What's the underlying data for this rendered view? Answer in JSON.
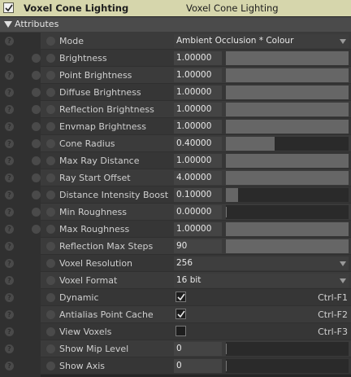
{
  "header": {
    "title": "Voxel Cone Lighting",
    "node_name": "Voxel Cone Lighting",
    "enabled": true
  },
  "section": {
    "label": "Attributes"
  },
  "rows": [
    {
      "label": "Mode",
      "type": "select",
      "value": "Ambient Occlusion * Colour"
    },
    {
      "label": "Brightness",
      "type": "slider",
      "value": "1.00000",
      "fill": 1.0
    },
    {
      "label": "Point Brightness",
      "type": "slider",
      "value": "1.00000",
      "fill": 1.0
    },
    {
      "label": "Diffuse Brightness",
      "type": "slider",
      "value": "1.00000",
      "fill": 1.0
    },
    {
      "label": "Reflection Brightness",
      "type": "slider",
      "value": "1.00000",
      "fill": 1.0
    },
    {
      "label": "Envmap Brightness",
      "type": "slider",
      "value": "1.00000",
      "fill": 1.0
    },
    {
      "label": "Cone Radius",
      "type": "slider",
      "value": "0.40000",
      "fill": 0.4
    },
    {
      "label": "Max Ray Distance",
      "type": "slider",
      "value": "1.00000",
      "fill": 1.0
    },
    {
      "label": "Ray Start Offset",
      "type": "slider",
      "value": "4.00000",
      "fill": 1.0
    },
    {
      "label": "Distance Intensity Boost",
      "type": "slider",
      "value": "0.10000",
      "fill": 0.1
    },
    {
      "label": "Min Roughness",
      "type": "slider",
      "value": "0.00000",
      "fill": 0.0
    },
    {
      "label": "Max Roughness",
      "type": "slider",
      "value": "1.00000",
      "fill": 1.0
    },
    {
      "label": "Reflection Max Steps",
      "type": "slider",
      "value": "90",
      "fill": 1.0
    },
    {
      "label": "Voxel Resolution",
      "type": "select",
      "value": "256"
    },
    {
      "label": "Voxel Format",
      "type": "select",
      "value": "16 bit"
    },
    {
      "label": "Dynamic",
      "type": "checkbox",
      "checked": true,
      "shortcut": "Ctrl-F1"
    },
    {
      "label": "Antialias Point Cache",
      "type": "checkbox",
      "checked": true,
      "shortcut": "Ctrl-F2"
    },
    {
      "label": "View Voxels",
      "type": "checkbox",
      "checked": false,
      "shortcut": "Ctrl-F3"
    },
    {
      "label": "Show Mip Level",
      "type": "slider",
      "value": "0",
      "fill": 0.0
    },
    {
      "label": "Show Axis",
      "type": "slider",
      "value": "0",
      "fill": 0.0
    }
  ],
  "icons": {
    "help": "help-icon",
    "reset": "reset-icon",
    "link": "link-icon"
  }
}
